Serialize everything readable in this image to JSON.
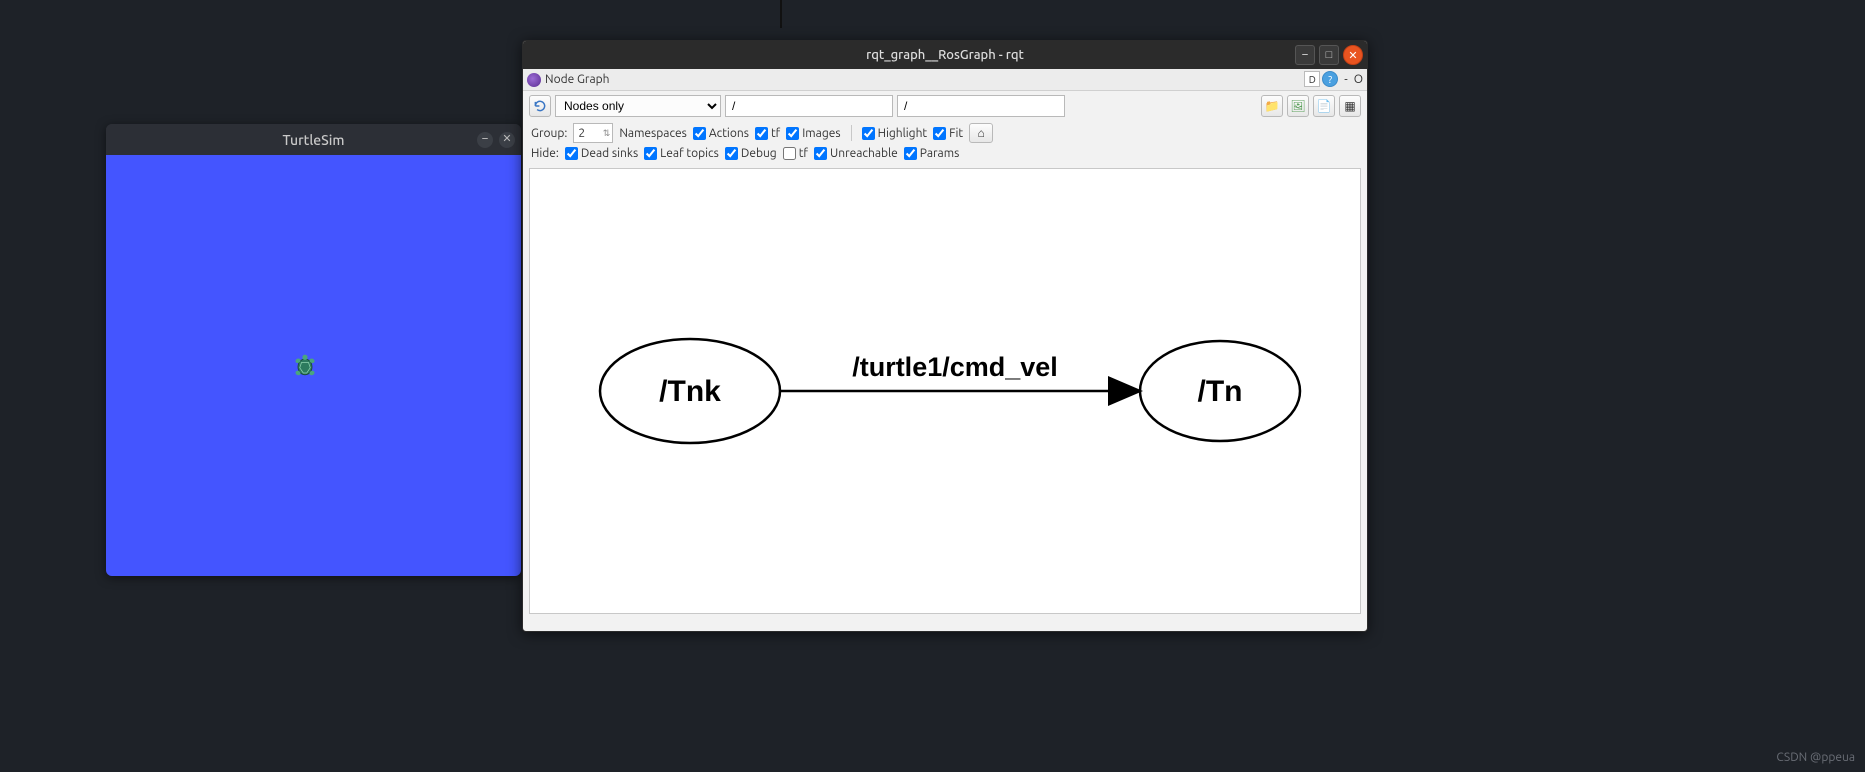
{
  "turtlesim": {
    "title": "TurtleSim"
  },
  "rqt": {
    "title": "rqt_graph__RosGraph - rqt",
    "dock_title": "Node Graph",
    "dock_right_d": "D",
    "dock_right_dash": "-",
    "dock_right_o": "O",
    "view_mode": "Nodes only",
    "ns_filter": "/",
    "topic_filter": "/",
    "group_label": "Group:",
    "group_value": "2",
    "chk_namespaces": "Namespaces",
    "chk_actions": "Actions",
    "chk_tf": "tf",
    "chk_images": "Images",
    "chk_highlight": "Highlight",
    "chk_fit": "Fit",
    "hide_label": "Hide:",
    "chk_deadsinks": "Dead sinks",
    "chk_leaftopics": "Leaf topics",
    "chk_debug": "Debug",
    "chk_tf2": "tf",
    "chk_unreachable": "Unreachable",
    "chk_params": "Params",
    "node_left": "/Tnk",
    "node_right": "/Tn",
    "edge_label": "/turtle1/cmd_vel"
  },
  "watermark": "CSDN @ppeua"
}
